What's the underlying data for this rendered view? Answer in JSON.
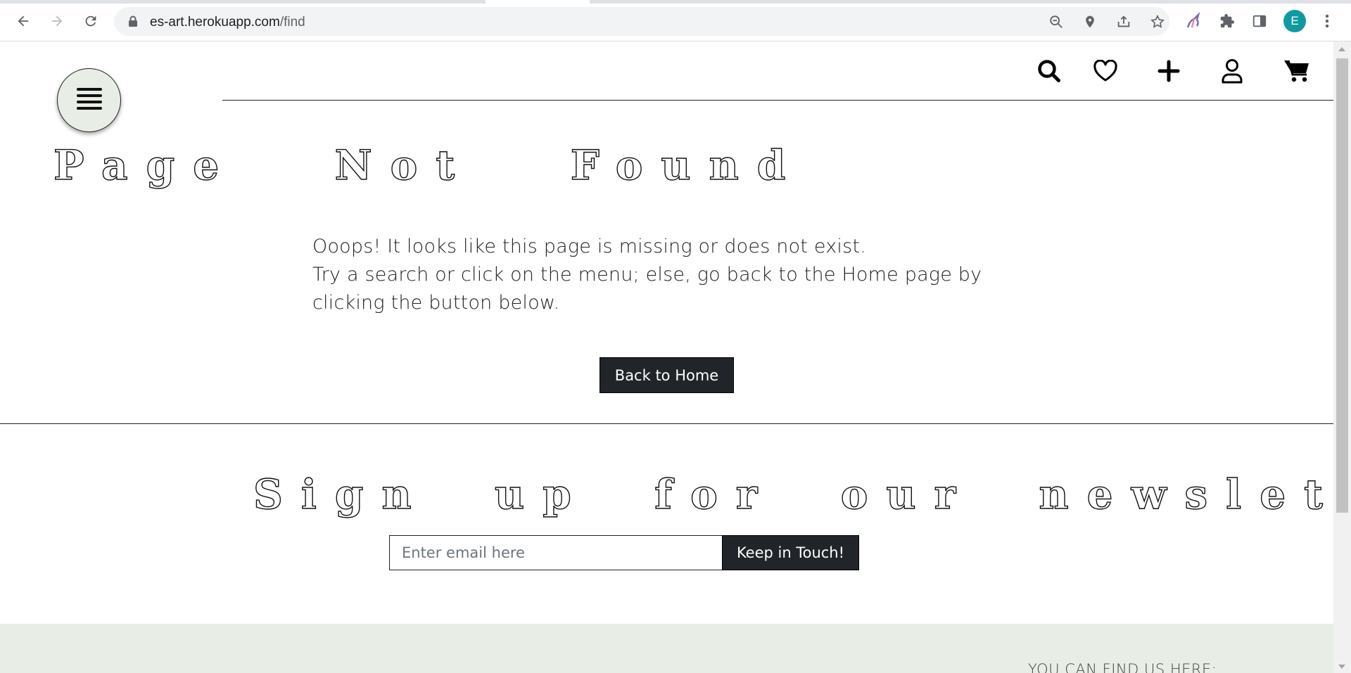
{
  "browser": {
    "url_host": "es-art.herokuapp.com",
    "url_path": "/find",
    "profile_initial": "E"
  },
  "header": {
    "icons": [
      "menu-icon",
      "search-icon",
      "heart-icon",
      "plus-icon",
      "user-icon",
      "cart-icon"
    ]
  },
  "main": {
    "title": "Page   Not   Found",
    "message_line1": "Ooops! It looks like this page is missing or does not exist.",
    "message_line2": "Try a search or click on the menu; else, go back to the Home page by clicking the button below.",
    "back_button": "Back to Home"
  },
  "newsletter": {
    "title": "Sign  up  for  our  newsletter",
    "email_placeholder": "Enter email here",
    "submit_label": "Keep in Touch!"
  },
  "footer": {
    "find_us": "YOU CAN FIND US HERE:",
    "accent_bg": "#e8ede6"
  },
  "colors": {
    "button_bg": "#212529",
    "menu_bg": "#e8eee6",
    "profile_bg": "#0f9aa0"
  }
}
